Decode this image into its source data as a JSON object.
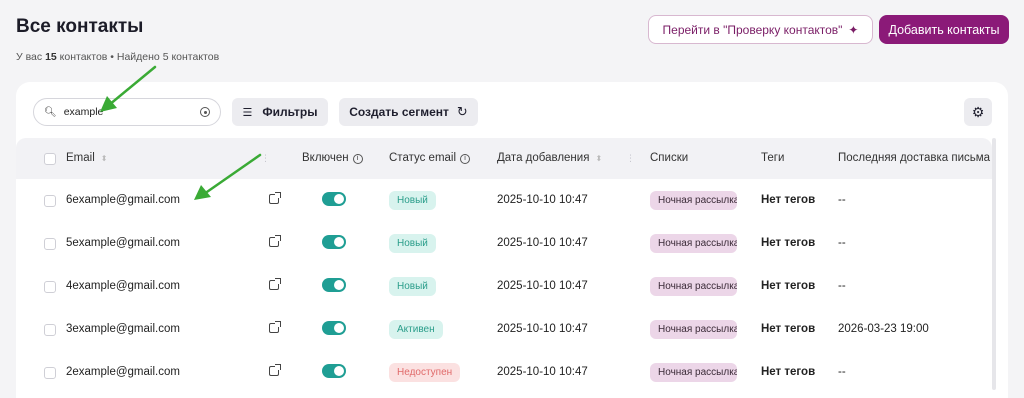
{
  "header": {
    "title": "Все контакты",
    "subtitle_prefix": "У вас",
    "contacts_count": "15",
    "subtitle_suffix": "контактов • Найдено 5 контактов",
    "check_button": "Перейти в \"Проверку контактов\"",
    "add_button": "Добавить контакты"
  },
  "toolbar": {
    "search_value": "example",
    "filters_label": "Фильтры",
    "segment_label": "Создать сегмент"
  },
  "table": {
    "columns": {
      "email": "Email",
      "enabled": "Включен",
      "status": "Статус email",
      "date": "Дата добавления",
      "lists": "Списки",
      "tags": "Теги",
      "last_delivery": "Последняя доставка письма"
    },
    "rows": [
      {
        "email": "6example@gmail.com",
        "status": "Новый",
        "status_kind": "ok",
        "date": "2025-10-10 10:47",
        "list": "Ночная рассылка",
        "tags": "Нет тегов",
        "last": "--"
      },
      {
        "email": "5example@gmail.com",
        "status": "Новый",
        "status_kind": "ok",
        "date": "2025-10-10 10:47",
        "list": "Ночная рассылка",
        "tags": "Нет тегов",
        "last": "--"
      },
      {
        "email": "4example@gmail.com",
        "status": "Новый",
        "status_kind": "ok",
        "date": "2025-10-10 10:47",
        "list": "Ночная рассылка",
        "tags": "Нет тегов",
        "last": "--"
      },
      {
        "email": "3example@gmail.com",
        "status": "Активен",
        "status_kind": "ok",
        "date": "2025-10-10 10:47",
        "list": "Ночная рассылка",
        "tags": "Нет тегов",
        "last": "2026-03-23 19:00"
      },
      {
        "email": "2example@gmail.com",
        "status": "Недоступен",
        "status_kind": "bad",
        "date": "2025-10-10 10:47",
        "list": "Ночная рассылка",
        "tags": "Нет тегов",
        "last": "--"
      }
    ]
  },
  "colors": {
    "brand": "#8b1a78",
    "toggle_on": "#1f9e94",
    "annotation_arrow": "#3aaa35"
  },
  "icons": [
    "magic-wand-icon",
    "search-icon",
    "clear-icon",
    "filter-icon",
    "refresh-icon",
    "gear-icon",
    "external-link-icon",
    "info-icon",
    "sort-icon"
  ]
}
